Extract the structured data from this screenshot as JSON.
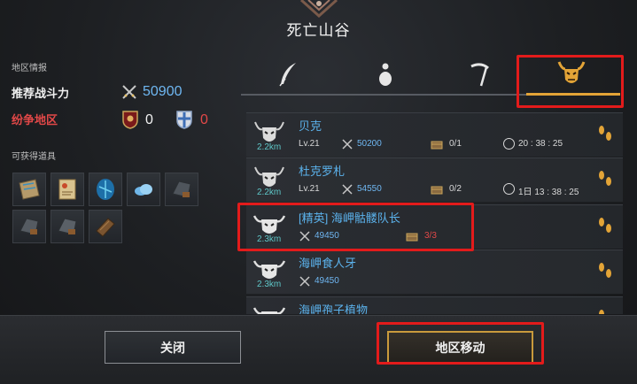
{
  "header": {
    "title": "死亡山谷"
  },
  "left": {
    "region_info_label": "地区情报",
    "power_label": "推荐战斗力",
    "power_value": "50900",
    "conflict_label": "纷争地区",
    "conflict_count_a": "0",
    "conflict_count_b": "0",
    "items_label": "可获得道具",
    "items": [
      "map-scroll-item",
      "scroll-item",
      "blue-gem-item",
      "cloud-item",
      "ore-item",
      "ore-item-2",
      "ore-item-3",
      "wood-item"
    ]
  },
  "tabs": [
    {
      "name": "feather-tab",
      "icon": "feather-icon"
    },
    {
      "name": "potion-tab",
      "icon": "gourd-icon"
    },
    {
      "name": "scythe-tab",
      "icon": "scythe-icon"
    },
    {
      "name": "boss-tab",
      "icon": "demon-skull-icon",
      "active": true
    }
  ],
  "monsters": [
    {
      "name": "贝克",
      "distance": "2.2km",
      "level": "Lv.21",
      "power": "50200",
      "ratio": "0/1",
      "time": "20 : 38 : 25"
    },
    {
      "name": "杜克罗札",
      "distance": "2.2km",
      "level": "Lv.21",
      "power": "54550",
      "ratio": "0/2",
      "time": "1日 13 : 38 : 25"
    },
    {
      "name": "[精英] 海岬骷髅队长",
      "distance": "2.3km",
      "power": "49450",
      "ratio": "3/3"
    },
    {
      "name": "海岬食人牙",
      "distance": "2.3km",
      "power": "49450"
    },
    {
      "name": "海岬孢子植物",
      "distance": ""
    }
  ],
  "buttons": {
    "close": "关闭",
    "move": "地区移动"
  },
  "colors": {
    "accent_gold": "#e3a437",
    "highlight_red": "#e31b1b",
    "name_blue": "#5bb2ec",
    "alert_red": "#e24848"
  }
}
